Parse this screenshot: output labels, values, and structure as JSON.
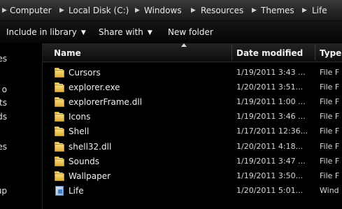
{
  "breadcrumb": {
    "items": [
      "Computer",
      "Local Disk (C:)",
      "Windows",
      "Resources",
      "Themes",
      "Life"
    ],
    "separator": "▶",
    "lead_separator": "▶"
  },
  "toolbar": {
    "include_label": "Include in library",
    "share_label": "Share with",
    "newfolder_label": "New folder"
  },
  "nav": {
    "items": [
      "es",
      "o",
      "ents",
      "ads",
      "es",
      "up"
    ]
  },
  "columns": {
    "name": "Name",
    "date": "Date modified",
    "type": "Type"
  },
  "files": [
    {
      "name": "Cursors",
      "date": "1/19/2011 3:43 ...",
      "type": "File F",
      "kind": "folder"
    },
    {
      "name": "explorer.exe",
      "date": "1/20/2011 3:51...",
      "type": "File F",
      "kind": "folder"
    },
    {
      "name": "explorerFrame.dll",
      "date": "1/19/2011 1:00 ...",
      "type": "File F",
      "kind": "folder"
    },
    {
      "name": "Icons",
      "date": "1/19/2011 3:46 ...",
      "type": "File F",
      "kind": "folder"
    },
    {
      "name": "Shell",
      "date": "1/17/2011 12:36...",
      "type": "File F",
      "kind": "folder"
    },
    {
      "name": "shell32.dll",
      "date": "1/20/2011 4:18...",
      "type": "File F",
      "kind": "folder"
    },
    {
      "name": "Sounds",
      "date": "1/19/2011 3:47 ...",
      "type": "File F",
      "kind": "folder"
    },
    {
      "name": "Wallpaper",
      "date": "1/19/2011 3:50...",
      "type": "File F",
      "kind": "folder"
    },
    {
      "name": "Life",
      "date": "1/20/2011 5:01...",
      "type": "Wind",
      "kind": "theme"
    }
  ],
  "icons": {
    "dropdown": "chevron-down-icon",
    "folder": "folder-icon",
    "theme": "theme-file-icon",
    "sort": "sort-ascending-icon"
  }
}
